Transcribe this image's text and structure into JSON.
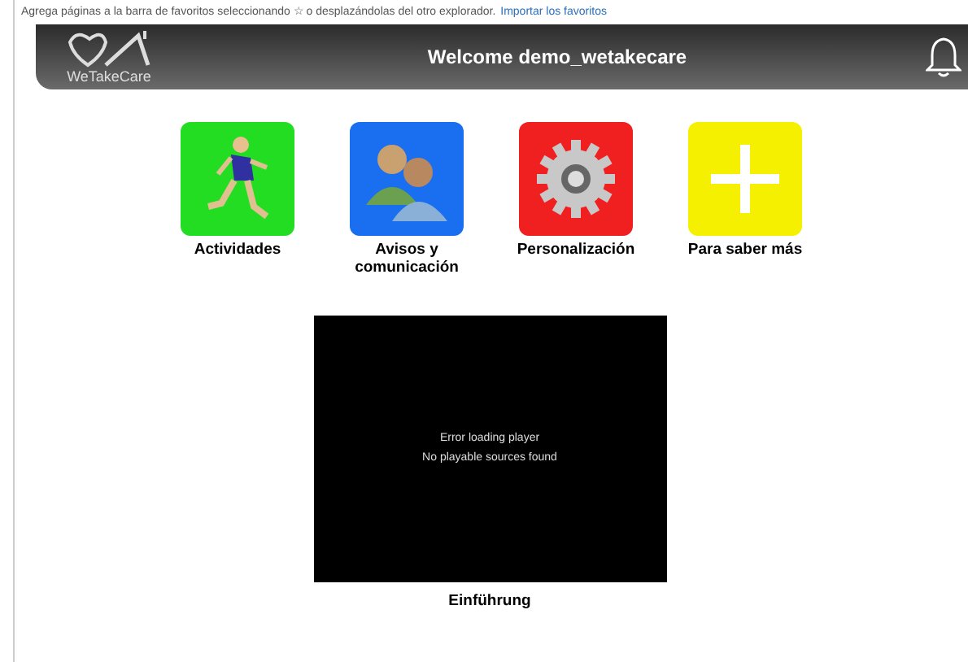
{
  "favorites_bar": {
    "text": "Agrega páginas a la barra de favoritos seleccionando ☆ o desplazándolas del otro explorador.",
    "link": "Importar los favoritos"
  },
  "header": {
    "logo": "WeTakeCare",
    "title": "Welcome demo_wetakecare"
  },
  "tiles": [
    {
      "kind": "runner",
      "label": "Actividades",
      "color": "#22dd22"
    },
    {
      "kind": "people",
      "label": "Avisos y comunicación",
      "color": "#1a6ff0"
    },
    {
      "kind": "gear",
      "label": "Personalización",
      "color": "#f02020"
    },
    {
      "kind": "plus",
      "label": "Para saber más",
      "color": "#f5f000"
    }
  ],
  "video": {
    "message": [
      "Error loading player",
      "No playable sources found"
    ],
    "caption": "Einführung"
  }
}
